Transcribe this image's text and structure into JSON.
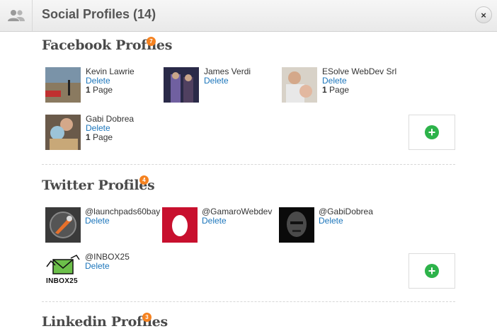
{
  "header": {
    "title": "Social Profiles (14)",
    "close_label": "×"
  },
  "facebook": {
    "title": "Facebook Profiles",
    "count": "7",
    "profiles": [
      {
        "name": "Kevin Lawrie",
        "delete": "Delete",
        "pages_num": "1",
        "pages_label": " Page"
      },
      {
        "name": "James Verdi",
        "delete": "Delete"
      },
      {
        "name": "ESolve WebDev Srl",
        "delete": "Delete",
        "pages_num": "1",
        "pages_label": " Page"
      },
      {
        "name": "Gabi Dobrea",
        "delete": "Delete",
        "pages_num": "1",
        "pages_label": " Page"
      }
    ],
    "add_label": "+"
  },
  "twitter": {
    "title": "Twitter Profiles",
    "count": "4",
    "profiles": [
      {
        "name": "@launchpads60bay",
        "delete": "Delete"
      },
      {
        "name": "@GamaroWebdev",
        "delete": "Delete"
      },
      {
        "name": "@GabiDobrea",
        "delete": "Delete"
      },
      {
        "name": "@INBOX25",
        "delete": "Delete",
        "logo_text": "INBOX25"
      }
    ],
    "add_label": "+"
  },
  "linkedin": {
    "title": "Linkedin Profiles",
    "count": "3"
  },
  "colors": {
    "accent_badge": "#f58220",
    "link": "#1b75bb",
    "add_green": "#2db34a"
  }
}
